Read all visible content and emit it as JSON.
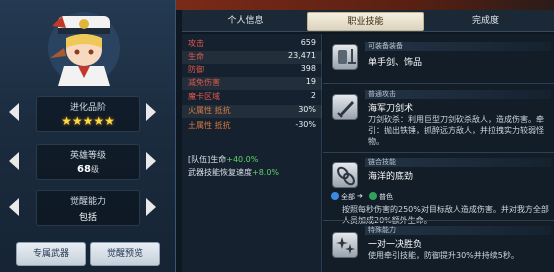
{
  "left_panel": {
    "evolution": {
      "label": "进化品阶",
      "stars": "★★★★★"
    },
    "hero_level": {
      "label": "英雄等级",
      "value": "68",
      "unit": "级"
    },
    "awaken": {
      "label": "觉醒能力",
      "value": "包括"
    },
    "buttons": {
      "exclusive_weapon": "专属武器",
      "awaken_preview": "觉醒预览"
    }
  },
  "tabs": [
    "个人信息",
    "职业技能",
    "完成度"
  ],
  "active_tab": 1,
  "stats": [
    {
      "key": "攻击",
      "value": "659"
    },
    {
      "key": "生命",
      "value": "23,471"
    },
    {
      "key": "防御",
      "value": "398"
    },
    {
      "key": "减免伤害",
      "value": "19"
    },
    {
      "key": "魔卡区域",
      "value": "2"
    },
    {
      "key": "火属性 抵抗",
      "value": "30%"
    },
    {
      "key": "土属性 抵抗",
      "value": "-30%"
    }
  ],
  "buffs": [
    {
      "text": "[队伍]生命",
      "bonus": "+40.0%"
    },
    {
      "text": "武器技能恢复速度",
      "bonus": "+8.0%"
    }
  ],
  "skills": [
    {
      "type": "可装备装备",
      "name": "单手剑、饰品",
      "desc": "",
      "icon": "sword-shield-icon"
    },
    {
      "type": "普通攻击",
      "name": "海军刀剑术",
      "desc": "刀剑砍杀：利用巨型刀剑砍杀敌人，造成伤害。牵引：抛出铁锤，抓醉远方敌人，并拉拽实力较弱怪物。",
      "icon": "sword-icon"
    },
    {
      "type": "链合技能",
      "name": "海洋的底劲",
      "desc": "按照每秒伤害的250%对目标敌人造成伤害。并对我方全部人员加成20%额外生命。",
      "icon": "chain-icon",
      "chain_from": "全部",
      "chain_to": "普色"
    },
    {
      "type": "特殊能力",
      "name": "一对一决胜负",
      "desc": "使用牵引技能，防御提升30%并持续5秒。",
      "icon": "sparkle-icon"
    }
  ],
  "colors": {
    "accent_tab": "#e9e2cc",
    "red_label": "#e0584a",
    "green_bonus": "#5fd36c"
  }
}
